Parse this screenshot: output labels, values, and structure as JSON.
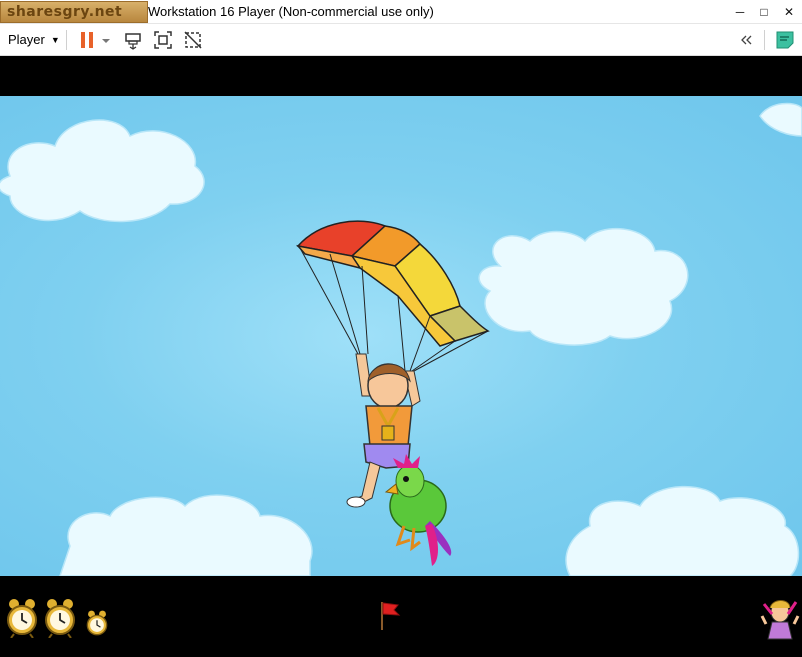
{
  "window": {
    "title": "Workstation 16 Player (Non-commercial use only)",
    "watermark": "sharesgry.net",
    "controls": {
      "minimize": "─",
      "maximize": "□",
      "close": "✕"
    }
  },
  "toolbar": {
    "player_menu_label": "Player",
    "icons": [
      "pause-icon",
      "pause-dropdown-icon",
      "send-ctrl-alt-del-icon",
      "fit-guest-icon",
      "unity-icon",
      "collapse-toolbar-icon",
      "notes-icon"
    ]
  },
  "game": {
    "scene": "sky-parachute",
    "colors": {
      "sky": "#7fd0f0",
      "cloud": "#eafaff",
      "canopy_red": "#e8412a",
      "canopy_orange": "#f29a2a",
      "canopy_yellow": "#f4d83a"
    }
  },
  "hud": {
    "timers": [
      "alarm-clock-icon",
      "alarm-clock-icon",
      "alarm-clock-small-icon"
    ],
    "flag": "red-flag-icon",
    "mascot": "fairy-mascot-icon"
  }
}
